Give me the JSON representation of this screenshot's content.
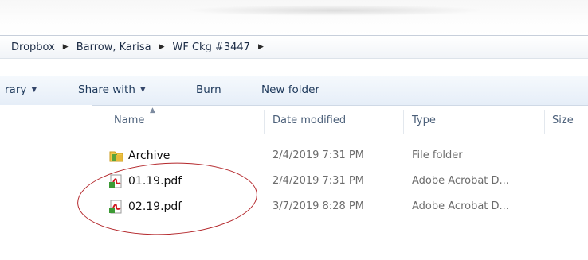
{
  "breadcrumb": {
    "items": [
      "Dropbox",
      "Barrow, Karisa",
      "WF Ckg #3447"
    ]
  },
  "toolbar": {
    "library_label": "rary",
    "share_label": "Share with",
    "burn_label": "Burn",
    "new_folder_label": "New folder"
  },
  "columns": {
    "name": "Name",
    "date": "Date modified",
    "type": "Type",
    "size": "Size"
  },
  "files": [
    {
      "name": "Archive",
      "date": "2/4/2019 7:31 PM",
      "type": "File folder",
      "icon": "folder-icon"
    },
    {
      "name": "01.19.pdf",
      "date": "2/4/2019 7:31 PM",
      "type": "Adobe Acrobat D...",
      "icon": "pdf-icon"
    },
    {
      "name": "02.19.pdf",
      "date": "3/7/2019 8:28 PM",
      "type": "Adobe Acrobat D...",
      "icon": "pdf-icon"
    }
  ],
  "annotation": {
    "color": "#b4282c"
  }
}
